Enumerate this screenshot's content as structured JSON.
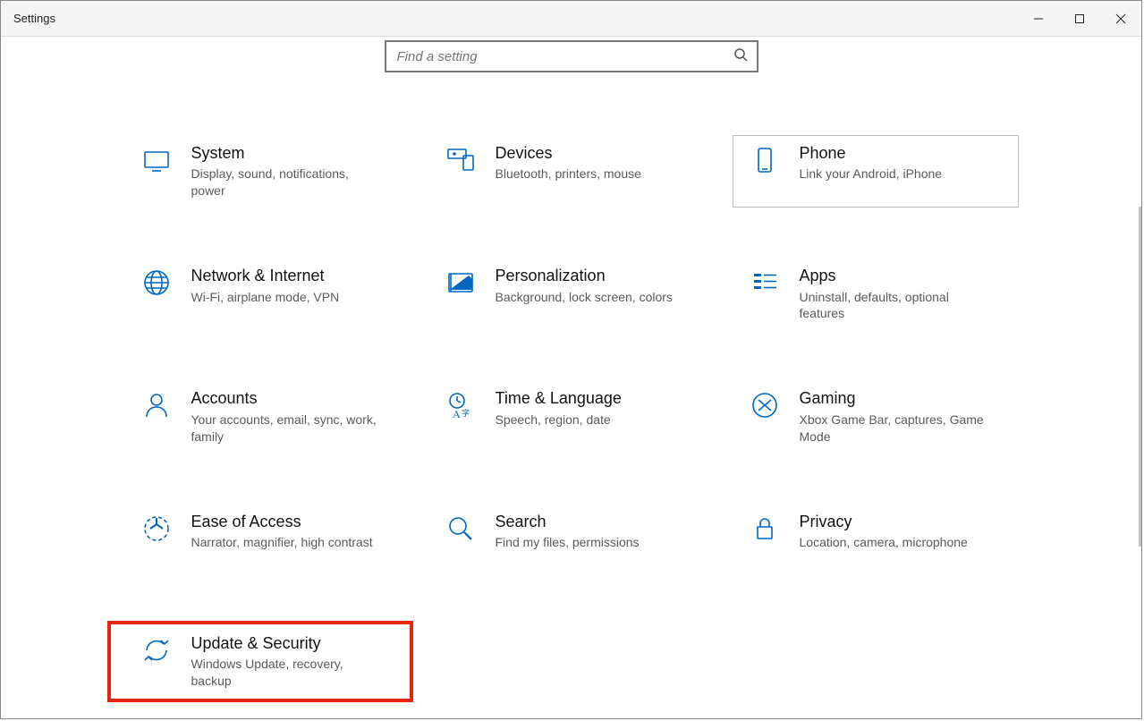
{
  "window": {
    "title": "Settings"
  },
  "search": {
    "placeholder": "Find a setting"
  },
  "tiles": [
    {
      "icon": "system",
      "title": "System",
      "desc": "Display, sound, notifications, power",
      "state": ""
    },
    {
      "icon": "devices",
      "title": "Devices",
      "desc": "Bluetooth, printers, mouse",
      "state": ""
    },
    {
      "icon": "phone",
      "title": "Phone",
      "desc": "Link your Android, iPhone",
      "state": "hovered"
    },
    {
      "icon": "network",
      "title": "Network & Internet",
      "desc": "Wi-Fi, airplane mode, VPN",
      "state": ""
    },
    {
      "icon": "personalization",
      "title": "Personalization",
      "desc": "Background, lock screen, colors",
      "state": ""
    },
    {
      "icon": "apps",
      "title": "Apps",
      "desc": "Uninstall, defaults, optional features",
      "state": ""
    },
    {
      "icon": "accounts",
      "title": "Accounts",
      "desc": "Your accounts, email, sync, work, family",
      "state": ""
    },
    {
      "icon": "time",
      "title": "Time & Language",
      "desc": "Speech, region, date",
      "state": ""
    },
    {
      "icon": "gaming",
      "title": "Gaming",
      "desc": "Xbox Game Bar, captures, Game Mode",
      "state": ""
    },
    {
      "icon": "ease",
      "title": "Ease of Access",
      "desc": "Narrator, magnifier, high contrast",
      "state": ""
    },
    {
      "icon": "search",
      "title": "Search",
      "desc": "Find my files, permissions",
      "state": ""
    },
    {
      "icon": "privacy",
      "title": "Privacy",
      "desc": "Location, camera, microphone",
      "state": ""
    },
    {
      "icon": "update",
      "title": "Update & Security",
      "desc": "Windows Update, recovery, backup",
      "state": "highlighted"
    }
  ]
}
